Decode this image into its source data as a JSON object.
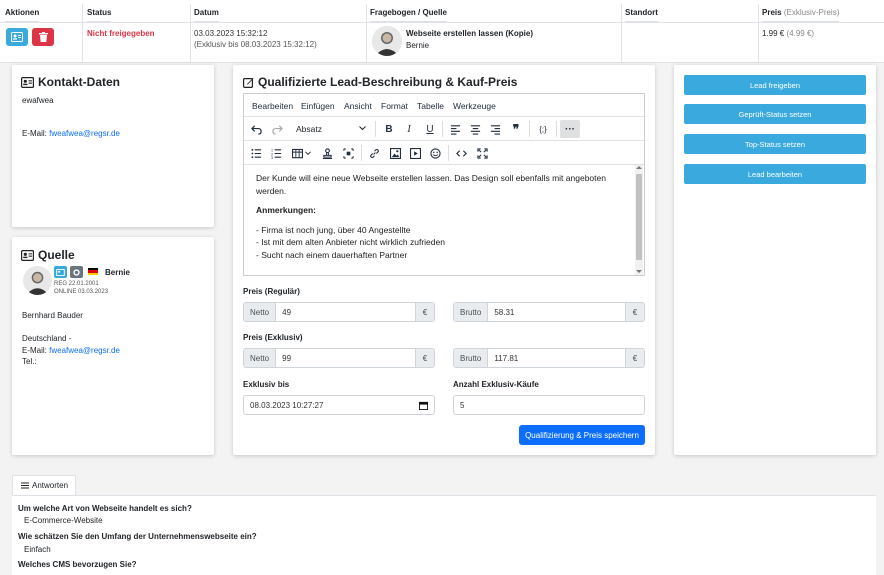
{
  "table": {
    "headers": [
      "Aktionen",
      "Status",
      "Datum",
      "Fragebogen / Quelle",
      "Standort",
      "Preis",
      "(Exklusiv-Preis)"
    ],
    "status": "Nicht freigegeben",
    "date": "03.03.2023 15:32:12",
    "date_exclusive": "(Exklusiv bis 08.03.2023 15:32:12)",
    "questionnaire_title": "Webseite erstellen lassen (Kopie)",
    "source_name": "Bernie",
    "price": "1.99 €",
    "price_exclusive": "(4.99 €)",
    "colors": {
      "status": "#dc3545",
      "btn_edit": "#3aa9de",
      "btn_delete": "#dc3545"
    }
  },
  "kontakt": {
    "title": "Kontakt-Daten",
    "name": "ewafwea",
    "email_label": "E-Mail:",
    "email": "fweafwea@regsr.de"
  },
  "quelle": {
    "title": "Quelle",
    "username": "Bernie",
    "reg": "REG 22.01.2001",
    "online": "ONLINE 03.03.2023",
    "full_name": "Bernhard Bauder",
    "country": "Deutschland -",
    "email_label": "E-Mail:",
    "email": "fweafwea@regsr.de",
    "tel_label": "Tel.:"
  },
  "lead": {
    "title": "Qualifizierte Lead-Beschreibung & Kauf-Preis",
    "menu": [
      "Bearbeiten",
      "Einfügen",
      "Ansicht",
      "Format",
      "Tabelle",
      "Werkzeuge"
    ],
    "block_format": "Absatz",
    "content": {
      "p1": "Der Kunde will eine neue Webseite erstellen lassen. Das Design soll ebenfalls mit angeboten werden.",
      "heading": "Anmerkungen:",
      "items": [
        "- Firma ist noch jung, über 40 Angestellte",
        "- Ist mit dem alten Anbieter nicht wirklich zufrieden",
        "- Sucht nach einem dauerhaften Partner"
      ]
    },
    "preis_regular_label": "Preis (Regulär)",
    "preis_exklusiv_label": "Preis (Exklusiv)",
    "netto_label": "Netto",
    "brutto_label": "Brutto",
    "currency": "€",
    "regular_netto": "49",
    "regular_brutto": "58.31",
    "exklusiv_netto": "99",
    "exklusiv_brutto": "117.81",
    "exklusiv_bis_label": "Exklusiv bis",
    "exklusiv_bis": "08.03.2023 10:27:27",
    "anzahl_label": "Anzahl Exklusiv-Käufe",
    "anzahl": "5",
    "save_label": "Qualifizierung & Preis speichern"
  },
  "actions": {
    "freigeben": "Lead freigeben",
    "geprueft": "Geprüft-Status setzen",
    "top": "Top-Status setzen",
    "bearbeiten": "Lead bearbeiten"
  },
  "answers": {
    "tab": "Antworten",
    "q1": "Um welche Art von Webseite handelt es sich?",
    "a1": "E-Commerce-Website",
    "q2": "Wie schätzen Sie den Umfang der Unternehmenswebseite ein?",
    "a2": "Einfach",
    "q3": "Welches CMS bevorzugen Sie?"
  }
}
